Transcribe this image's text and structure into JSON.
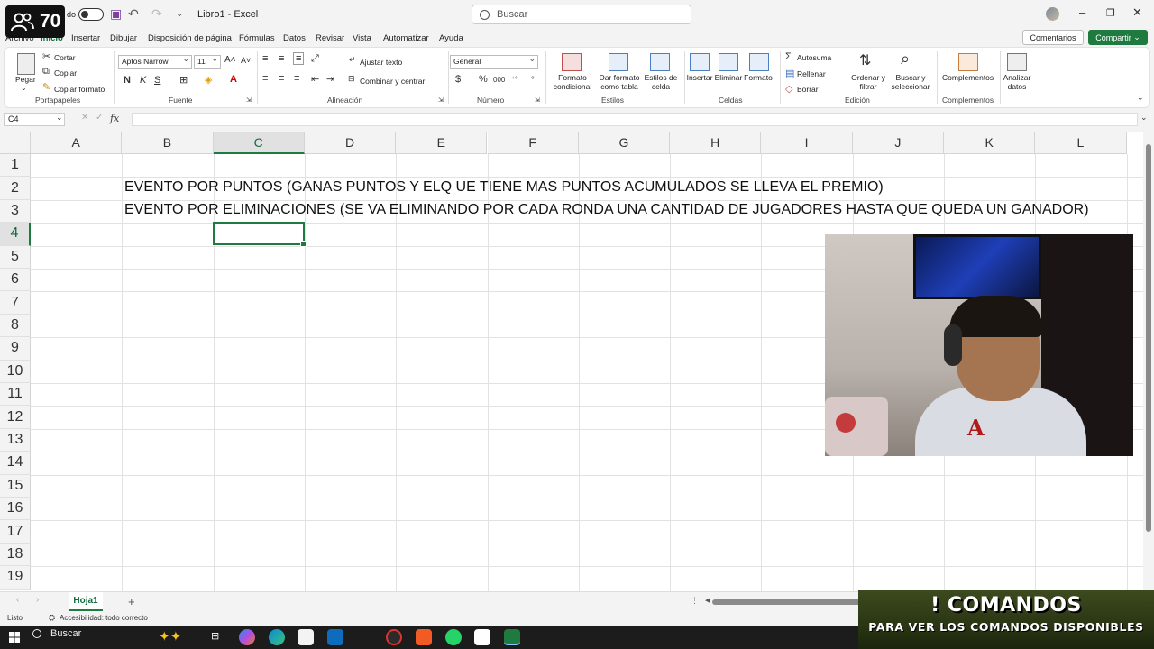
{
  "overlay": {
    "viewer_count": "70",
    "autosave_label": "do"
  },
  "titlebar": {
    "doc_title": "Libro1 - Excel",
    "search_placeholder": "Buscar"
  },
  "tabs": [
    "Archivo",
    "Inicio",
    "Insertar",
    "Dibujar",
    "Disposición de página",
    "Fórmulas",
    "Datos",
    "Revisar",
    "Vista",
    "Automatizar",
    "Ayuda"
  ],
  "actions": {
    "comments": "Comentarios",
    "share": "Compartir"
  },
  "ribbon": {
    "clipboard": {
      "paste": "Pegar",
      "cut": "Cortar",
      "copy": "Copiar",
      "format_painter": "Copiar formato",
      "label": "Portapapeles"
    },
    "font": {
      "name": "Aptos Narrow",
      "size": "11",
      "bold": "N",
      "italic": "K",
      "underline": "S",
      "label": "Fuente"
    },
    "alignment": {
      "wrap": "Ajustar texto",
      "merge": "Combinar y centrar",
      "label": "Alineación"
    },
    "number": {
      "format": "General",
      "label": "Número"
    },
    "styles": {
      "conditional": "Formato condicional",
      "as_table": "Dar formato como tabla",
      "cell_styles": "Estilos de celda",
      "label": "Estilos"
    },
    "cells": {
      "insert": "Insertar",
      "delete": "Eliminar",
      "format": "Formato",
      "label": "Celdas"
    },
    "editing": {
      "autosum": "Autosuma",
      "fill": "Rellenar",
      "clear": "Borrar",
      "sort_filter": "Ordenar y filtrar",
      "find_select": "Buscar y seleccionar",
      "label": "Edición"
    },
    "addins": {
      "addins": "Complementos",
      "label": "Complementos"
    },
    "analyze": {
      "label": "Analizar datos"
    }
  },
  "formula_bar": {
    "name_box": "C4",
    "fx": "fx",
    "value": ""
  },
  "grid": {
    "columns": [
      "A",
      "B",
      "C",
      "D",
      "E",
      "F",
      "G",
      "H",
      "I",
      "J",
      "K",
      "L"
    ],
    "rows": [
      "1",
      "2",
      "3",
      "4",
      "5",
      "6",
      "7",
      "8",
      "9",
      "10",
      "11",
      "12",
      "13",
      "14",
      "15",
      "16",
      "17",
      "18",
      "19"
    ],
    "selected_column": "C",
    "selected_row": "4",
    "cells": {
      "B2": "EVENTO POR PUNTOS (GANAS PUNTOS Y ELQ UE TIENE MAS PUNTOS ACUMULADOS SE LLEVA EL PREMIO)",
      "B3": "EVENTO POR ELIMINACIONES (SE VA ELIMINANDO POR CADA RONDA UNA CANTIDAD DE JUGADORES HASTA QUE QUEDA UN GANADOR)"
    }
  },
  "sheets": {
    "active": "Hoja1"
  },
  "status": {
    "ready": "Listo",
    "accessibility": "Accesibilidad: todo correcto"
  },
  "commands_overlay": {
    "title": "! COMANDOS",
    "subtitle": "PARA VER LOS COMANDOS DISPONIBLES"
  },
  "taskbar": {
    "search": "Buscar"
  }
}
